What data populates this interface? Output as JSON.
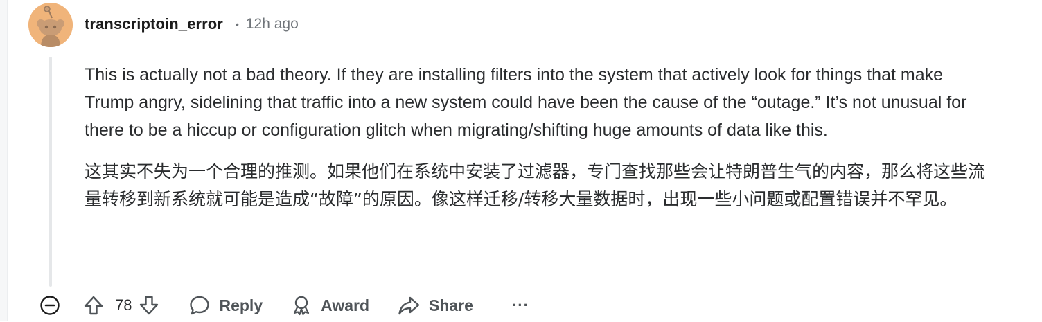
{
  "comment": {
    "author": "transcriptoin_error",
    "separator": "•",
    "timestamp": "12h ago",
    "paragraphs_en": "This is actually not a bad theory. If they are installing filters into the system that actively look for things that make Trump angry, sidelining that traffic into a new system could have been the cause of the “outage.” It’s not unusual for there to be a hiccup or configuration glitch when migrating/shifting huge amounts of data like this.",
    "paragraphs_zh": "这其实不失为一个合理的推测。如果他们在系统中安装了过滤器，专门查找那些会让特朗普生气的内容，那么将这些流量转移到新系统就可能是造成“故障”的原因。像这样迁移/转移大量数据时，出现一些小问题或配置错误并不罕见。"
  },
  "actions": {
    "score": "78",
    "reply_label": "Reply",
    "award_label": "Award",
    "share_label": "Share",
    "more_label": "···"
  },
  "icons": {
    "avatar": "snoo-avatar",
    "collapse": "collapse-minus-icon",
    "upvote": "upvote-arrow-icon",
    "downvote": "downvote-arrow-icon",
    "reply": "speech-bubble-icon",
    "award": "award-ribbon-icon",
    "share": "share-arrow-icon"
  },
  "colors": {
    "avatar_bg": "#f0b47a",
    "text": "#1c1c1c",
    "muted": "#6f7479",
    "action": "#4f5458"
  }
}
